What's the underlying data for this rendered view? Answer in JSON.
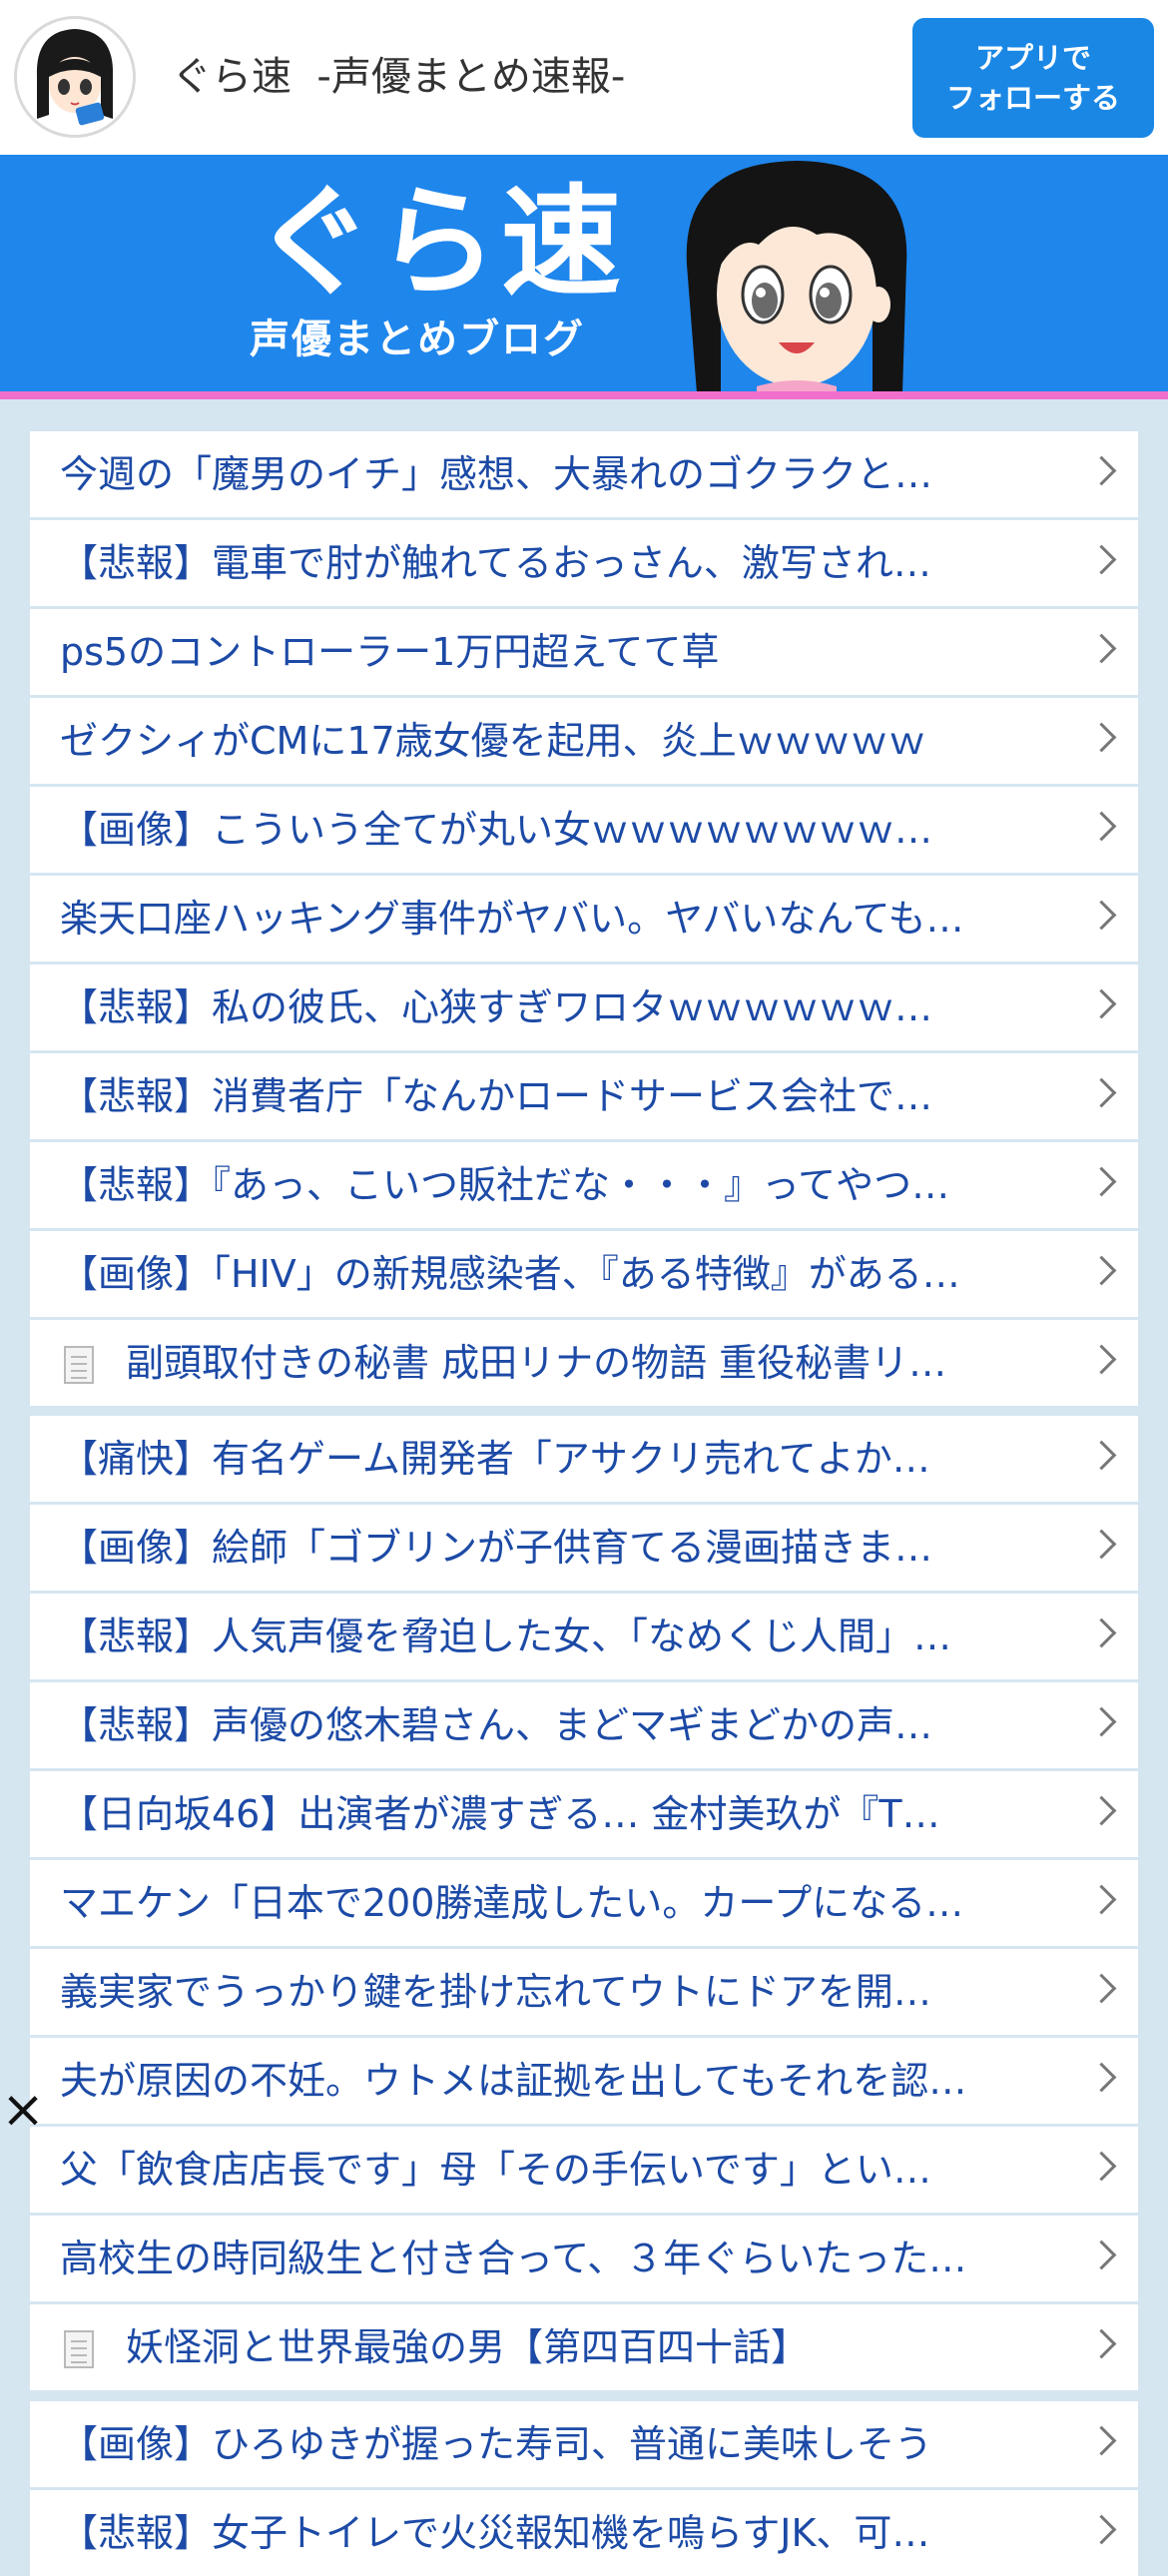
{
  "header": {
    "site_title": "ぐら速  -声優まとめ速報-",
    "follow_line1": "アプリで",
    "follow_line2": "フォローする"
  },
  "banner": {
    "logo": "ぐら速",
    "subtitle": "声優まとめブログ"
  },
  "groups": [
    {
      "items": [
        {
          "title": "今週の「魔男のイチ」感想、大暴れのゴクラクと…",
          "doc": false
        },
        {
          "title": "【悲報】電車で肘が触れてるおっさん、激写され…",
          "doc": false
        },
        {
          "title": "ps5のコントローラー1万円超えてて草",
          "doc": false
        },
        {
          "title": "ゼクシィがCMに17歳女優を起用、炎上ｗｗｗｗｗ",
          "doc": false
        },
        {
          "title": "【画像】こういう全てが丸い女ｗｗｗｗｗｗｗｗ…",
          "doc": false
        },
        {
          "title": "楽天口座ハッキング事件がヤバい。ヤバいなんても…",
          "doc": false
        },
        {
          "title": "【悲報】私の彼氏、心狭すぎワロタｗｗｗｗｗｗ…",
          "doc": false
        },
        {
          "title": "【悲報】消費者庁「なんかロードサービス会社で…",
          "doc": false
        },
        {
          "title": "【悲報】『あっ、こいつ販社だな・・・』ってやつ…",
          "doc": false
        },
        {
          "title": "【画像】「HIV」の新規感染者、『ある特徴』がある…",
          "doc": false
        },
        {
          "title": "副頭取付きの秘書 成田リナの物語 重役秘書リ…",
          "doc": true
        }
      ]
    },
    {
      "items": [
        {
          "title": "【痛快】有名ゲーム開発者「アサクリ売れてよか…",
          "doc": false
        },
        {
          "title": "【画像】絵師「ゴブリンが子供育てる漫画描きま…",
          "doc": false
        },
        {
          "title": "【悲報】人気声優を脅迫した女、「なめくじ人間」…",
          "doc": false
        },
        {
          "title": "【悲報】声優の悠木碧さん、まどマギまどかの声…",
          "doc": false
        },
        {
          "title": "【日向坂46】出演者が濃すぎる… 金村美玖が『T…",
          "doc": false
        },
        {
          "title": "マエケン「日本で200勝達成したい。カープになる…",
          "doc": false
        },
        {
          "title": "義実家でうっかり鍵を掛け忘れてウトにドアを開…",
          "doc": false
        },
        {
          "title": "夫が原因の不妊。ウトメは証拠を出してもそれを認…",
          "doc": false
        },
        {
          "title": "父「飲食店店長です」母「その手伝いです」とい…",
          "doc": false
        },
        {
          "title": "高校生の時同級生と付き合って、３年ぐらいたった…",
          "doc": false
        },
        {
          "title": "妖怪洞と世界最強の男【第四百四十話】",
          "doc": true
        }
      ]
    },
    {
      "items": [
        {
          "title": "【画像】ひろゆきが握った寿司、普通に美味しそう",
          "doc": false
        },
        {
          "title": "【悲報】女子トイレで火災報知機を鳴らすJK、可…",
          "doc": false
        }
      ]
    }
  ],
  "colors": {
    "accent": "#1a87e5",
    "banner_bg": "#1f86ec",
    "banner_stripe": "#f06fcd",
    "link": "#1c4aa6",
    "page_bg": "#d5e6f1"
  }
}
